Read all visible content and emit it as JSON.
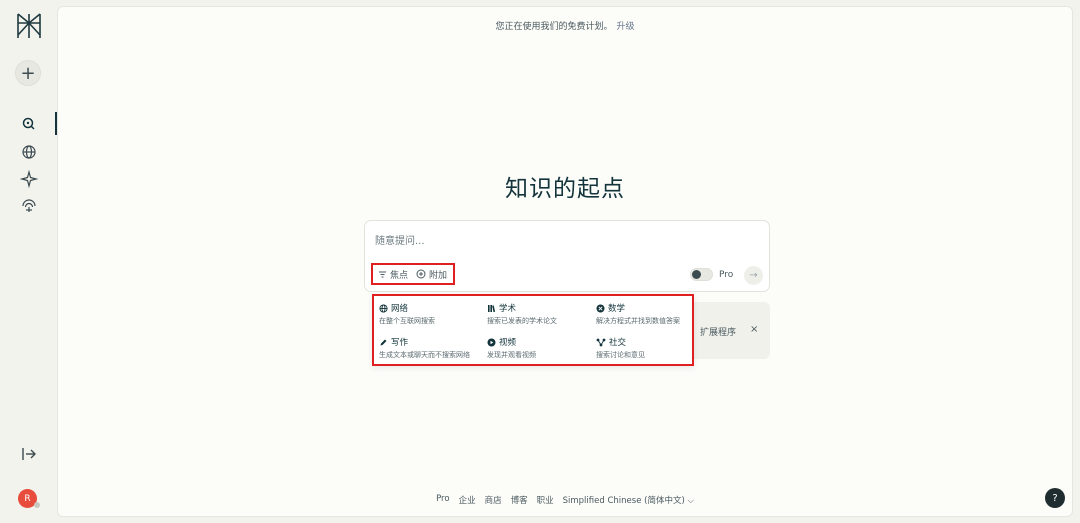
{
  "plan_banner": {
    "text": "您正在使用我们的免费计划。",
    "upgrade": "升级"
  },
  "headline": "知识的起点",
  "ask": {
    "placeholder": "随意提问...",
    "focus_label": "焦点",
    "attach_label": "附加",
    "pro_label": "Pro"
  },
  "extension_card": {
    "label": "扩展程序",
    "close": "×"
  },
  "focus_options": [
    {
      "title": "网络",
      "desc": "在整个互联网搜索",
      "icon": "globe-icon"
    },
    {
      "title": "学术",
      "desc": "搜索已发表的学术论文",
      "icon": "books-icon"
    },
    {
      "title": "数学",
      "desc": "解决方程式并找到数值答案",
      "icon": "math-icon"
    },
    {
      "title": "写作",
      "desc": "生成文本或聊天而不搜索网络",
      "icon": "pencil-icon"
    },
    {
      "title": "视频",
      "desc": "发现并观看视频",
      "icon": "play-icon"
    },
    {
      "title": "社交",
      "desc": "搜索讨论和意见",
      "icon": "social-icon"
    }
  ],
  "footer": {
    "links": [
      "Pro",
      "企业",
      "商店",
      "博客",
      "职业"
    ],
    "language": "Simplified Chinese (简体中文)",
    "language_chevron": "⌵"
  },
  "sidebar": {
    "new_label": "+",
    "avatar_initial": "R",
    "help_label": "?"
  }
}
